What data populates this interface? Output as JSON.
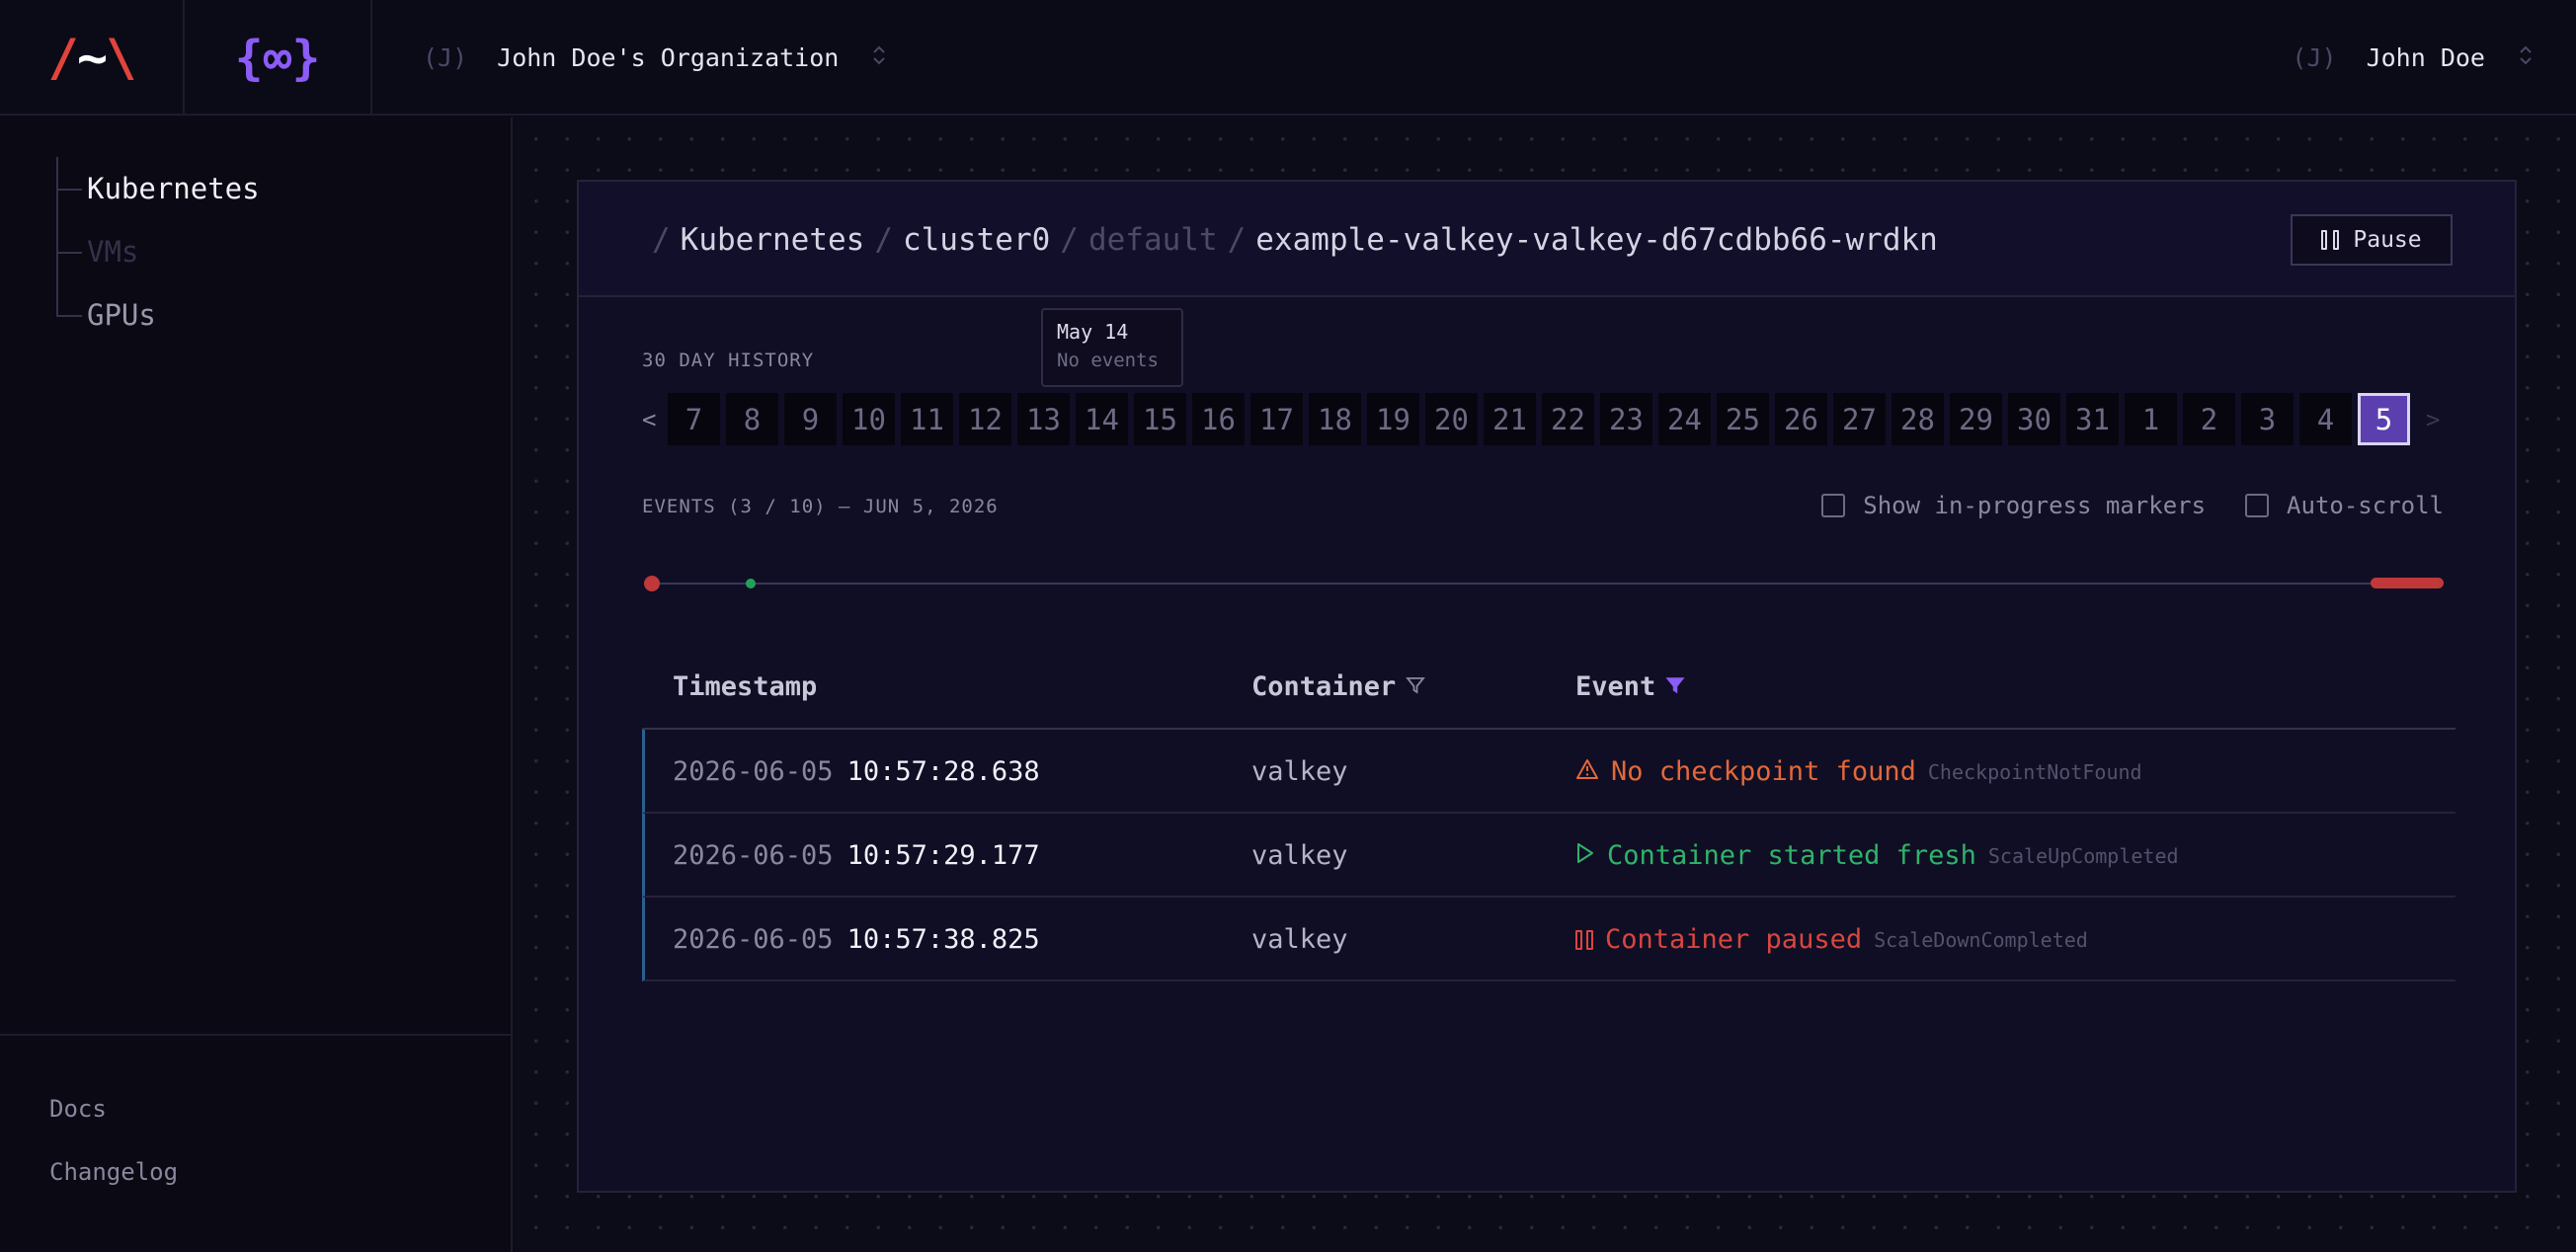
{
  "brand": {
    "logo_left": "/~\\",
    "logo_left_parts": [
      "/",
      "~",
      "\\"
    ],
    "logo_right": "{∞}"
  },
  "org": {
    "initial": "(J)",
    "name": "John Doe's Organization",
    "switch": "⌃⌄"
  },
  "user": {
    "initial": "(J)",
    "name": "John Doe",
    "switch": "⌃⌄"
  },
  "sidebar": {
    "items": [
      {
        "label": "Kubernetes",
        "state": "active"
      },
      {
        "label": "VMs",
        "state": "disabled"
      },
      {
        "label": "GPUs",
        "state": "normal"
      }
    ],
    "footer": {
      "docs": "Docs",
      "changelog": "Changelog"
    }
  },
  "breadcrumb": {
    "items": [
      "Kubernetes",
      "cluster0",
      "default",
      "example-valkey-valkey-d67cdbb66-wrdkn"
    ],
    "sep": "/"
  },
  "pause_label": "Pause",
  "history": {
    "label": "30 DAY HISTORY",
    "prev": "<",
    "next": ">",
    "days": [
      "7",
      "8",
      "9",
      "10",
      "11",
      "12",
      "13",
      "14",
      "15",
      "16",
      "17",
      "18",
      "19",
      "20",
      "21",
      "22",
      "23",
      "24",
      "25",
      "26",
      "27",
      "28",
      "29",
      "30",
      "31",
      "1",
      "2",
      "3",
      "4",
      "5"
    ],
    "selected": "5",
    "tooltip": {
      "date": "May 14",
      "text": "No events"
    }
  },
  "events": {
    "label": "EVENTS (3 / 10) — JUN 5, 2026",
    "opt_markers": "Show in-progress markers",
    "opt_autoscroll": "Auto-scroll"
  },
  "table": {
    "headers": {
      "timestamp": "Timestamp",
      "container": "Container",
      "event": "Event"
    },
    "rows": [
      {
        "date": "2026-06-05",
        "time": "10:57:28.638",
        "container": "valkey",
        "event": "No checkpoint found",
        "code": "CheckpointNotFound",
        "kind": "warning"
      },
      {
        "date": "2026-06-05",
        "time": "10:57:29.177",
        "container": "valkey",
        "event": "Container started fresh",
        "code": "ScaleUpCompleted",
        "kind": "start"
      },
      {
        "date": "2026-06-05",
        "time": "10:57:38.825",
        "container": "valkey",
        "event": "Container paused",
        "code": "ScaleDownCompleted",
        "kind": "pause"
      }
    ]
  },
  "colors": {
    "accent": "#8b5cf6",
    "selected_day": "#5b3fae",
    "warning": "#e3683a",
    "success": "#2fb36a",
    "danger": "#d9463f"
  }
}
